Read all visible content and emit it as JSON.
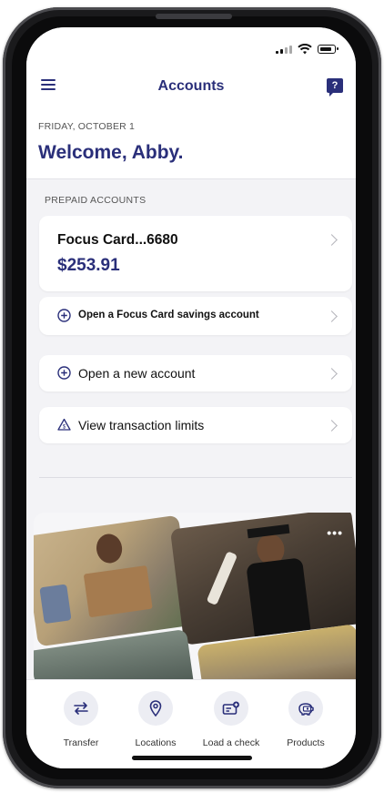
{
  "nav": {
    "title": "Accounts",
    "menu_icon": "hamburger-menu-icon",
    "help_icon": "chat-help-icon",
    "help_glyph": "?"
  },
  "welcome": {
    "date": "FRIDAY, OCTOBER 1",
    "greeting": "Welcome, Abby."
  },
  "prepaid": {
    "section_label": "PREPAID ACCOUNTS",
    "account": {
      "name": "Focus Card...6680",
      "balance": "$253.91"
    },
    "savings_link": "Open a Focus Card savings account"
  },
  "actions": [
    {
      "label": "Open a new account",
      "icon": "plus-circle-icon"
    },
    {
      "label": "View transaction limits",
      "icon": "warning-triangle-icon"
    }
  ],
  "promo": {
    "more_label": "•••"
  },
  "tabs": [
    {
      "label": "Transfer",
      "icon": "transfer-arrows-icon"
    },
    {
      "label": "Locations",
      "icon": "location-pin-icon"
    },
    {
      "label": "Load a check",
      "icon": "check-deposit-icon"
    },
    {
      "label": "Products",
      "icon": "piggy-bank-icon"
    }
  ],
  "colors": {
    "brand": "#2a2f7a",
    "background": "#f3f3f6"
  }
}
